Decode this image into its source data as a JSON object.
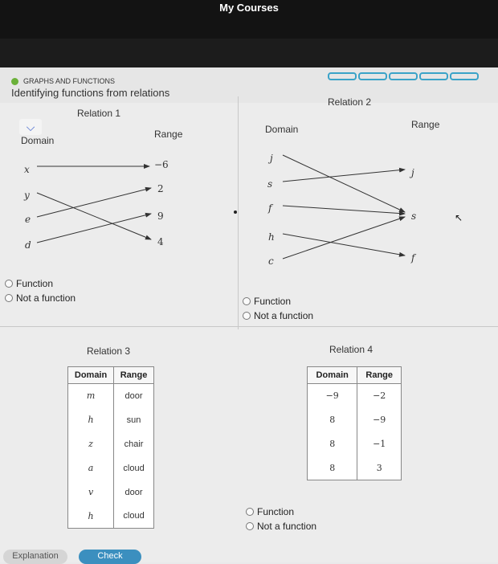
{
  "header": {
    "title": "My Courses"
  },
  "lesson": {
    "topic": "GRAPHS AND FUNCTIONS",
    "title": "Identifying functions from relations"
  },
  "colors": {
    "topic_dot": "#6bb13a",
    "progress": "#3aa3c8",
    "check_button": "#3b8fbf"
  },
  "relation1": {
    "title": "Relation 1",
    "domain_label": "Domain",
    "range_label": "Range",
    "domain": [
      "x",
      "y",
      "e",
      "d"
    ],
    "range": [
      "−6",
      "2",
      "9",
      "4"
    ],
    "options": [
      "Function",
      "Not a function"
    ]
  },
  "relation2": {
    "title": "Relation 2",
    "domain_label": "Domain",
    "range_label": "Range",
    "domain": [
      "j",
      "s",
      "f",
      "h",
      "c"
    ],
    "range": [
      "j",
      "s",
      "f"
    ],
    "options": [
      "Function",
      "Not a function"
    ]
  },
  "relation3": {
    "title": "Relation 3",
    "headers": [
      "Domain",
      "Range"
    ],
    "rows": [
      [
        "m",
        "door"
      ],
      [
        "h",
        "sun"
      ],
      [
        "z",
        "chair"
      ],
      [
        "a",
        "cloud"
      ],
      [
        "v",
        "door"
      ],
      [
        "h",
        "cloud"
      ]
    ]
  },
  "relation4": {
    "title": "Relation 4",
    "headers": [
      "Domain",
      "Range"
    ],
    "rows": [
      [
        "−9",
        "−2"
      ],
      [
        "8",
        "−9"
      ],
      [
        "8",
        "−1"
      ],
      [
        "8",
        "3"
      ]
    ],
    "options": [
      "Function",
      "Not a function"
    ]
  },
  "buttons": {
    "explanation": "Explanation",
    "check": "Check"
  }
}
